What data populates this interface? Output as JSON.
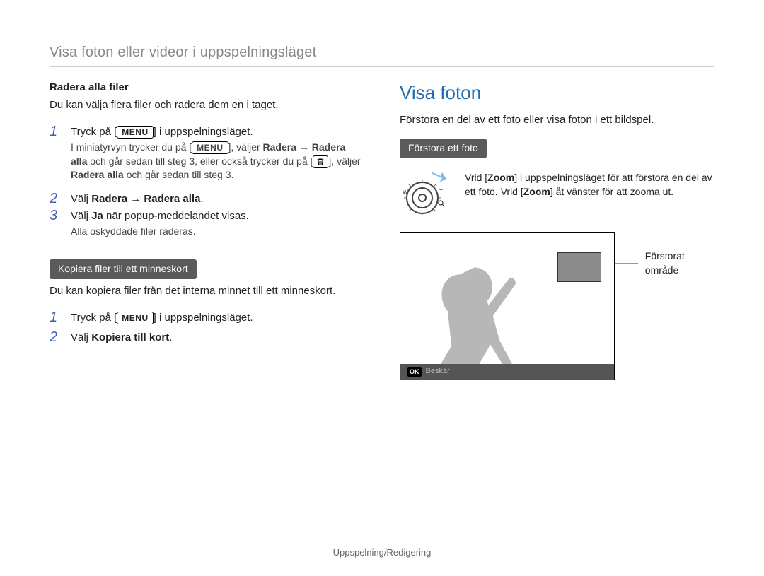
{
  "header": "Visa foton eller videor i uppspelningsläget",
  "left": {
    "deleteAll": {
      "title": "Radera alla filer",
      "desc": "Du kan välja flera filer och radera dem en i taget.",
      "step1_pre": "Tryck på [",
      "step1_btn": "MENU",
      "step1_post": "] i uppspelningsläget.",
      "note_a": "I miniatyrvyn trycker du på [",
      "note_b": "], väljer ",
      "note_radera": "Radera",
      "note_arrow": " → ",
      "note_radera_alla": "Radera alla",
      "note_c": " och går sedan till steg 3, eller också trycker du på [",
      "note_d": "], väljer ",
      "note_e": " och går sedan till steg 3.",
      "step2_pre": "Välj ",
      "step2_b1": "Radera",
      "step2_mid": " → ",
      "step2_b2": "Radera alla",
      "step2_post": ".",
      "step3_pre": "Välj ",
      "step3_b": "Ja",
      "step3_post": " när popup-meddelandet visas.",
      "step3_note": "Alla oskyddade filer raderas."
    },
    "copy": {
      "pill": "Kopiera filer till ett minneskort",
      "desc": "Du kan kopiera filer från det interna minnet till ett minneskort.",
      "step1_pre": "Tryck på [",
      "step1_btn": "MENU",
      "step1_post": "] i uppspelningsläget.",
      "step2_pre": "Välj ",
      "step2_b": "Kopiera till kort",
      "step2_post": "."
    }
  },
  "right": {
    "title": "Visa foton",
    "desc": "Förstora en del av ett foto eller visa foton i ett bildspel.",
    "zoomPill": "Förstora ett foto",
    "zoomText_a": "Vrid [",
    "zoomText_b": "Zoom",
    "zoomText_c": "] i uppspelningsläget för att förstora en del av ett foto. Vrid [",
    "zoomText_d": "Zoom",
    "zoomText_e": "] åt vänster för att zooma ut.",
    "statusbar_ok": "OK",
    "statusbar_label": "Beskär",
    "callout": "Förstorat område"
  },
  "footer": "Uppspelning/Redigering"
}
